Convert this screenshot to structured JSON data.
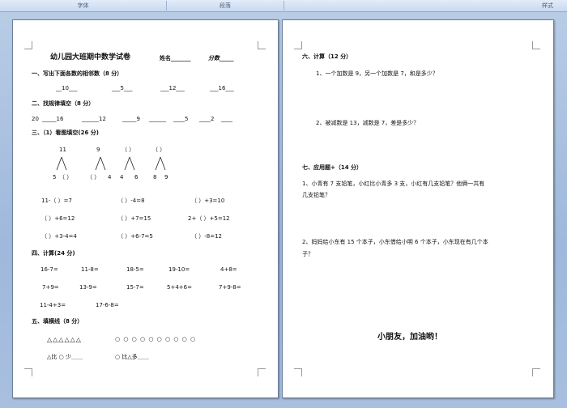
{
  "ribbon": {
    "font": "字体",
    "paragraph": "段落",
    "styles": "样式"
  },
  "left": {
    "title": "幼儿园大班期中数学试卷",
    "name_label": "姓名_______",
    "score_label": "分数_____",
    "s1": {
      "heading": "一、写出下面各数的相邻数（8 分）",
      "items": [
        "__10___",
        "___5___",
        "___12___",
        "___16___"
      ]
    },
    "s2": {
      "heading": "二、找规律填空（8 分）",
      "seq": [
        "20",
        "_____16",
        "______12",
        "_____9",
        "______",
        "____5",
        "____2",
        "____"
      ]
    },
    "s3": {
      "heading": "三、（1）看图填空(26 分)",
      "tops": [
        "11",
        "9",
        "（   ）",
        "（   ）"
      ],
      "bottoms": [
        [
          "5",
          "（   ）"
        ],
        [
          "（   ）",
          "4"
        ],
        [
          "4",
          "6"
        ],
        [
          "8",
          "9"
        ]
      ],
      "rows": [
        [
          "11-（   ）=7",
          "（   ）-4=8",
          "（   ）+3=10"
        ],
        [
          "（   ）+6=12",
          "（   ）+7=15",
          "2+（   ）+5=12"
        ],
        [
          "（   ）+3-4=4",
          "（   ）+6-7=5",
          "（   ）-8=12"
        ]
      ]
    },
    "s4": {
      "heading": "四、计算(24 分)",
      "rows": [
        [
          "16-7=",
          "11-8=",
          "18-5=",
          "19-10=",
          "4+8="
        ],
        [
          "7+9=",
          "13-9=",
          "15-7=",
          "5+4+6=",
          "7+9-8="
        ],
        [
          "11-4+3=",
          "17-6-8="
        ]
      ]
    },
    "s5": {
      "heading": "五、填横线（8 分）",
      "triangles": "△△△△△△",
      "circles": "○ ○ ○ ○ ○ ○ ○ ○ ○ ○",
      "q1": "△比 ○ 少＿＿",
      "q2": "○ 比△多＿＿"
    }
  },
  "right": {
    "s6": {
      "heading": "六、计算（12 分）",
      "q1": "1、一个加数是 9，另一个加数是 7，和是多少？",
      "q2": "2、被减数是 13，减数是 7，差是多少？"
    },
    "s7": {
      "heading": "七、应用题+（14 分）",
      "q1a": "1、小青有 7 支铅笔，小红比小青多 3 支，小红有几支铅笔？他俩一共有",
      "q1b": "几支铅笔？",
      "q2a": "2、妈妈给小东有 15 个本子，小东借给小明 6 个本子，小东现在有几个本",
      "q2b": "子？"
    },
    "closing": "小朋友，加油哟！"
  }
}
